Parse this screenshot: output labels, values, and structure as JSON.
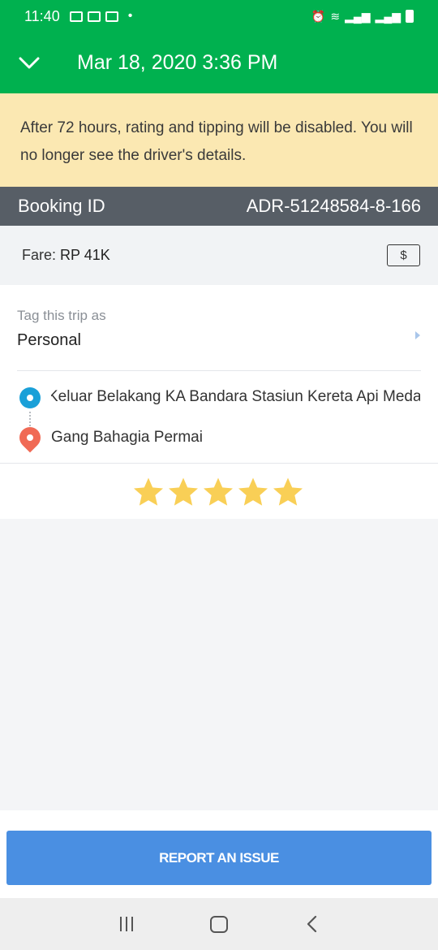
{
  "status_bar": {
    "time": "11:40"
  },
  "app_bar": {
    "title": "Mar 18, 2020 3:36 PM",
    "back_icon": "chevron-down-icon"
  },
  "notice": {
    "text": "After 72 hours, rating and tipping will be disabled. You will no longer see the driver's details."
  },
  "booking": {
    "label": "Booking ID",
    "id": "ADR-51248584-8-166"
  },
  "fare": {
    "label": "Fare:",
    "value": "RP 41K",
    "payment_icon": "$"
  },
  "tag": {
    "label": "Tag this trip as",
    "value": "Personal"
  },
  "route": {
    "pickup": "Keluar Belakang KA Bandara Stasiun Kereta Api Medan",
    "dropoff": "Gang Bahagia Permai"
  },
  "rating": {
    "stars": 5,
    "max": 5
  },
  "footer": {
    "report_label": "REPORT AN ISSUE"
  },
  "colors": {
    "brand": "#00b14f",
    "notice_bg": "#fbe8b2",
    "booking_bar": "#575e66",
    "button": "#4a8fe2",
    "star": "#f9cf56",
    "pickup": "#1aa0d8",
    "dropoff": "#f06a55"
  }
}
